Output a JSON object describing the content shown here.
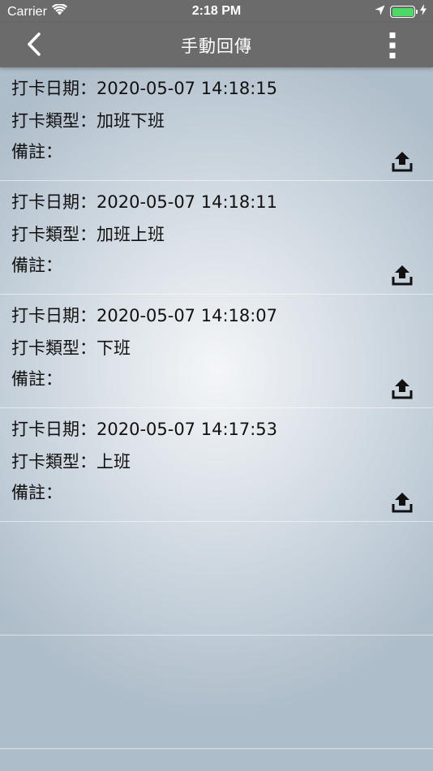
{
  "status_bar": {
    "carrier": "Carrier",
    "time": "2:18 PM",
    "battery_level": 1.0,
    "battery_color": "#4cd964"
  },
  "nav": {
    "title": "手動回傳",
    "back_icon": "chevron-left-icon",
    "menu_icon": "more-vertical-icon",
    "bar_color": "#6b6b6b"
  },
  "labels": {
    "date": "打卡日期：",
    "type": "打卡類型：",
    "note": "備註："
  },
  "records": [
    {
      "datetime": "2020-05-07 14:18:15",
      "type": "加班下班",
      "note": ""
    },
    {
      "datetime": "2020-05-07 14:18:11",
      "type": "加班上班",
      "note": ""
    },
    {
      "datetime": "2020-05-07 14:18:07",
      "type": "下班",
      "note": ""
    },
    {
      "datetime": "2020-05-07 14:17:53",
      "type": "上班",
      "note": ""
    }
  ]
}
